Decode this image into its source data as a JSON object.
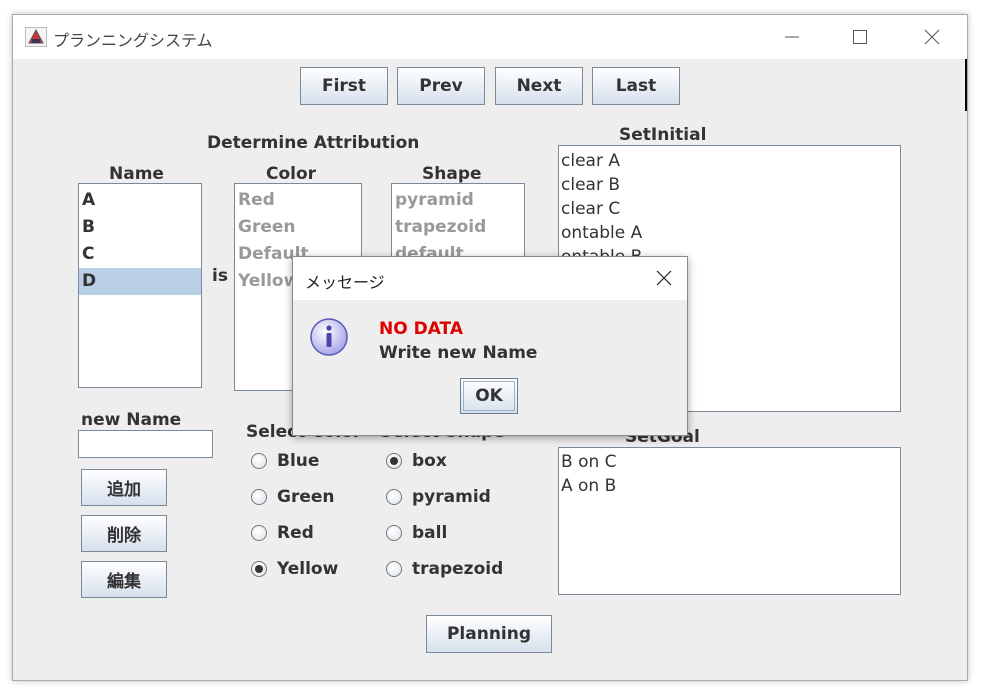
{
  "window": {
    "title": "プランニングシステム"
  },
  "nav": {
    "first": "First",
    "prev": "Prev",
    "next": "Next",
    "last": "Last"
  },
  "attribution": {
    "heading": "Determine Attribution",
    "name_label": "Name",
    "color_label": "Color",
    "shape_label": "Shape",
    "is_label": "is",
    "names": [
      "A",
      "B",
      "C",
      "D"
    ],
    "selected_name": "D",
    "colors": [
      "Red",
      "Green",
      "Default",
      "Yellow"
    ],
    "shapes": [
      "pyramid",
      "trapezoid",
      "default"
    ]
  },
  "new_name": {
    "label": "new Name",
    "value": ""
  },
  "actions": {
    "add": "追加",
    "delete": "削除",
    "edit": "編集"
  },
  "select_color": {
    "label": "Select Color",
    "options": [
      "Blue",
      "Green",
      "Red",
      "Yellow"
    ],
    "selected": "Yellow"
  },
  "select_shape": {
    "label": "Select Shape",
    "options": [
      "box",
      "pyramid",
      "ball",
      "trapezoid"
    ],
    "selected": "box"
  },
  "set_initial": {
    "label": "SetInitial",
    "lines": [
      "clear A",
      "clear B",
      "clear C",
      "ontable A",
      "ontable B"
    ]
  },
  "set_goal": {
    "label": "SetGoal",
    "lines": [
      "B on C",
      "A on B"
    ]
  },
  "planning": "Planning",
  "dialog": {
    "title": "メッセージ",
    "message_error": "NO DATA",
    "message_body": "Write new Name",
    "ok": "OK"
  },
  "colors": {
    "error_text": "#e00000",
    "selection": "#b8cfe5"
  }
}
